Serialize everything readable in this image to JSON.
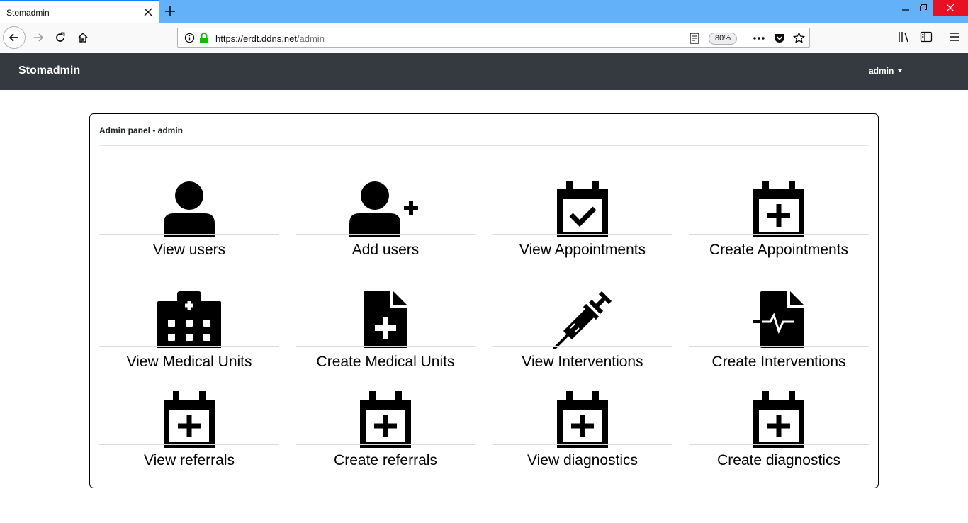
{
  "browser": {
    "tab_title": "Stomadmin",
    "url_host": "https://erdt.ddns.net",
    "url_path": "/admin",
    "zoom": "80%"
  },
  "app": {
    "brand": "Stomadmin",
    "user": "admin"
  },
  "panel": {
    "header": "Admin panel - admin",
    "tiles": [
      {
        "label": "View users",
        "icon": "user-icon"
      },
      {
        "label": "Add users",
        "icon": "user-plus-icon"
      },
      {
        "label": "View Appointments",
        "icon": "calendar-check-icon"
      },
      {
        "label": "Create Appointments",
        "icon": "calendar-plus-icon"
      },
      {
        "label": "View Medical Units",
        "icon": "hospital-icon"
      },
      {
        "label": "Create Medical Units",
        "icon": "file-medical-icon"
      },
      {
        "label": "View Interventions",
        "icon": "syringe-icon"
      },
      {
        "label": "Create Interventions",
        "icon": "file-medical-alt-icon"
      },
      {
        "label": "View referrals",
        "icon": "calendar-plus-icon"
      },
      {
        "label": "Create referrals",
        "icon": "calendar-plus-icon"
      },
      {
        "label": "View diagnostics",
        "icon": "calendar-plus-icon"
      },
      {
        "label": "Create diagnostics",
        "icon": "calendar-plus-icon"
      }
    ]
  }
}
